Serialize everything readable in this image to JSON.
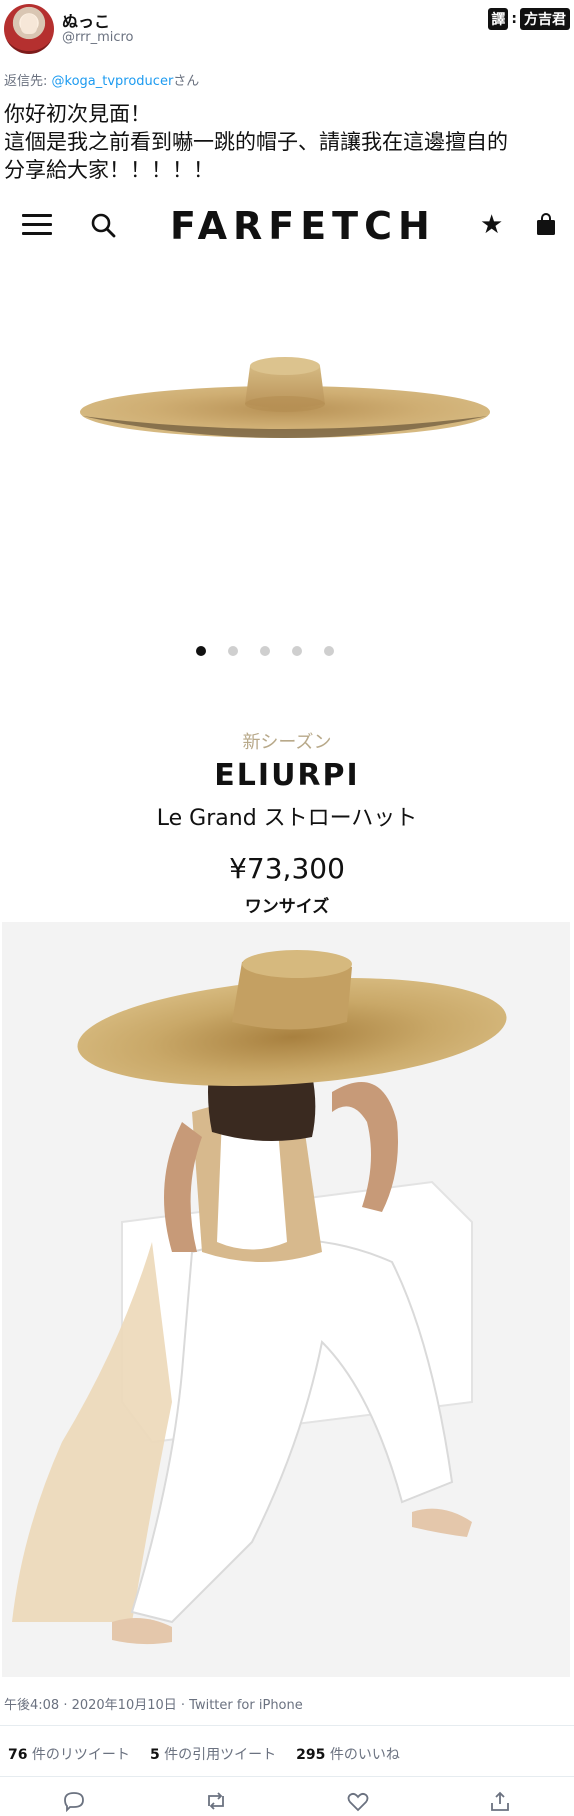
{
  "tweet": {
    "display_name": "ぬっこ",
    "handle": "@rrr_micro",
    "reply_prefix": "返信先: ",
    "reply_mention": "@koga_tvproducer",
    "reply_suffix": "さん",
    "text_lines": [
      "你好初次見面！",
      "這個是我之前看到嚇一跳的帽子、請讓我在這邊擅自的",
      "分享給大家！！！！！"
    ],
    "meta": "午後4:08 · 2020年10月10日 · Twitter for iPhone",
    "stats": {
      "retweets_count": "76",
      "retweets_label": " 件のリツイート",
      "quotes_count": "5",
      "quotes_label": " 件の引用ツイート",
      "likes_count": "295",
      "likes_label": " 件のいいね"
    }
  },
  "watermark": {
    "part1": "譯",
    "separator": ":",
    "part2": "方吉君"
  },
  "farfetch": {
    "logo": "FARFETCH",
    "carousel": {
      "total": 5,
      "active_index": 0
    },
    "season": "新シーズン",
    "brand": "ELIURPI",
    "product_name": "Le Grand ストローハット",
    "price": "¥73,300",
    "size": "ワンサイズ"
  },
  "icons": {
    "nav": [
      "hamburger-menu-icon",
      "search-icon",
      "star-icon",
      "shopping-bag-icon"
    ],
    "actions": [
      "reply-icon",
      "retweet-icon",
      "like-icon",
      "share-icon"
    ]
  },
  "colors": {
    "link": "#1d9bf0",
    "muted": "#6b7280",
    "season": "#b8a98a",
    "straw": "#c9a868"
  }
}
